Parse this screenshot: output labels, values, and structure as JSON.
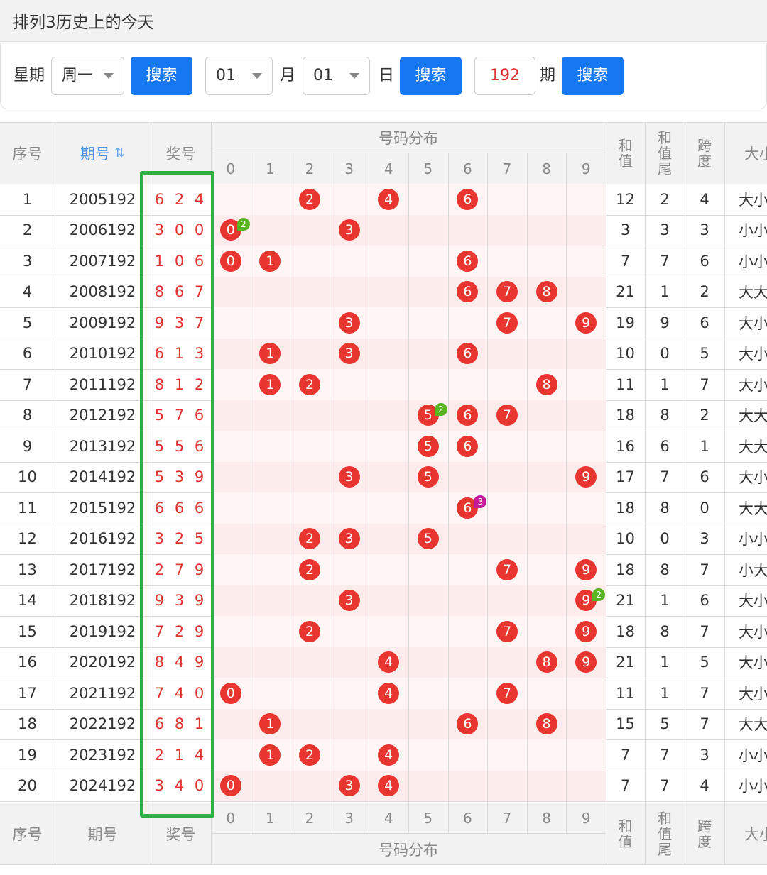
{
  "title": "排列3历史上的今天",
  "filters": {
    "weekday_label": "星期",
    "weekday_value": "周一",
    "search_label": "搜索",
    "month_value": "01",
    "month_label": "月",
    "day_value": "01",
    "day_label": "日",
    "issue_value": "192",
    "issue_label": "期"
  },
  "table": {
    "header": {
      "seq": "序号",
      "period": "期号",
      "prize": "奖号",
      "distribution": "号码分布",
      "digits": [
        "0",
        "1",
        "2",
        "3",
        "4",
        "5",
        "6",
        "7",
        "8",
        "9"
      ],
      "sum": "和值",
      "sum_tail": "和值尾",
      "span": "跨度",
      "size": "大小"
    },
    "rows": [
      {
        "seq": "1",
        "period": "2005192",
        "prize": "6 2 4",
        "sum": "12",
        "tail": "2",
        "span": "4",
        "size": "大小"
      },
      {
        "seq": "2",
        "period": "2006192",
        "prize": "3 0 0",
        "sum": "3",
        "tail": "3",
        "span": "3",
        "size": "小小"
      },
      {
        "seq": "3",
        "period": "2007192",
        "prize": "1 0 6",
        "sum": "7",
        "tail": "7",
        "span": "6",
        "size": "小小"
      },
      {
        "seq": "4",
        "period": "2008192",
        "prize": "8 6 7",
        "sum": "21",
        "tail": "1",
        "span": "2",
        "size": "大大"
      },
      {
        "seq": "5",
        "period": "2009192",
        "prize": "9 3 7",
        "sum": "19",
        "tail": "9",
        "span": "6",
        "size": "大小"
      },
      {
        "seq": "6",
        "period": "2010192",
        "prize": "6 1 3",
        "sum": "10",
        "tail": "0",
        "span": "5",
        "size": "大小"
      },
      {
        "seq": "7",
        "period": "2011192",
        "prize": "8 1 2",
        "sum": "11",
        "tail": "1",
        "span": "7",
        "size": "大小"
      },
      {
        "seq": "8",
        "period": "2012192",
        "prize": "5 7 6",
        "sum": "18",
        "tail": "8",
        "span": "2",
        "size": "大大"
      },
      {
        "seq": "9",
        "period": "2013192",
        "prize": "5 5 6",
        "sum": "16",
        "tail": "6",
        "span": "1",
        "size": "大大"
      },
      {
        "seq": "10",
        "period": "2014192",
        "prize": "5 3 9",
        "sum": "17",
        "tail": "7",
        "span": "6",
        "size": "大小"
      },
      {
        "seq": "11",
        "period": "2015192",
        "prize": "6 6 6",
        "sum": "18",
        "tail": "8",
        "span": "0",
        "size": "大大"
      },
      {
        "seq": "12",
        "period": "2016192",
        "prize": "3 2 5",
        "sum": "10",
        "tail": "0",
        "span": "3",
        "size": "小小"
      },
      {
        "seq": "13",
        "period": "2017192",
        "prize": "2 7 9",
        "sum": "18",
        "tail": "8",
        "span": "7",
        "size": "小大"
      },
      {
        "seq": "14",
        "period": "2018192",
        "prize": "9 3 9",
        "sum": "21",
        "tail": "1",
        "span": "6",
        "size": "大小"
      },
      {
        "seq": "15",
        "period": "2019192",
        "prize": "7 2 9",
        "sum": "18",
        "tail": "8",
        "span": "7",
        "size": "大小"
      },
      {
        "seq": "16",
        "period": "2020192",
        "prize": "8 4 9",
        "sum": "21",
        "tail": "1",
        "span": "5",
        "size": "大小"
      },
      {
        "seq": "17",
        "period": "2021192",
        "prize": "7 4 0",
        "sum": "11",
        "tail": "1",
        "span": "7",
        "size": "大小"
      },
      {
        "seq": "18",
        "period": "2022192",
        "prize": "6 8 1",
        "sum": "15",
        "tail": "5",
        "span": "7",
        "size": "大大"
      },
      {
        "seq": "19",
        "period": "2023192",
        "prize": "2 1 4",
        "sum": "7",
        "tail": "7",
        "span": "3",
        "size": "小小"
      },
      {
        "seq": "20",
        "period": "2024192",
        "prize": "3 4 0",
        "sum": "7",
        "tail": "7",
        "span": "4",
        "size": "小小"
      }
    ],
    "balls": [
      [
        2,
        4,
        6
      ],
      [
        0,
        3
      ],
      [
        0,
        1,
        6
      ],
      [
        6,
        7,
        8
      ],
      [
        3,
        7,
        9
      ],
      [
        1,
        3,
        6
      ],
      [
        1,
        2,
        8
      ],
      [
        5,
        6,
        7
      ],
      [
        5,
        6
      ],
      [
        3,
        5,
        9
      ],
      [
        6
      ],
      [
        2,
        3,
        5
      ],
      [
        2,
        7,
        9
      ],
      [
        3,
        9
      ],
      [
        2,
        7,
        9
      ],
      [
        4,
        8,
        9
      ],
      [
        0,
        4,
        7
      ],
      [
        1,
        6,
        8
      ],
      [
        1,
        2,
        4
      ],
      [
        0,
        3,
        4
      ]
    ],
    "repeat_badges": [
      {
        "row": 1,
        "digit": 0,
        "count": "2",
        "color": "#58b51f"
      },
      {
        "row": 7,
        "digit": 5,
        "count": "2",
        "color": "#58b51f"
      },
      {
        "row": 10,
        "digit": 6,
        "count": "3",
        "color": "#c3199b"
      },
      {
        "row": 13,
        "digit": 9,
        "count": "2",
        "color": "#58b51f"
      }
    ]
  },
  "colors": {
    "accent": "#1677f2",
    "ball": "#e9352f",
    "highlight_box": "#2fae41",
    "row_stripe": "#fdeeee"
  }
}
